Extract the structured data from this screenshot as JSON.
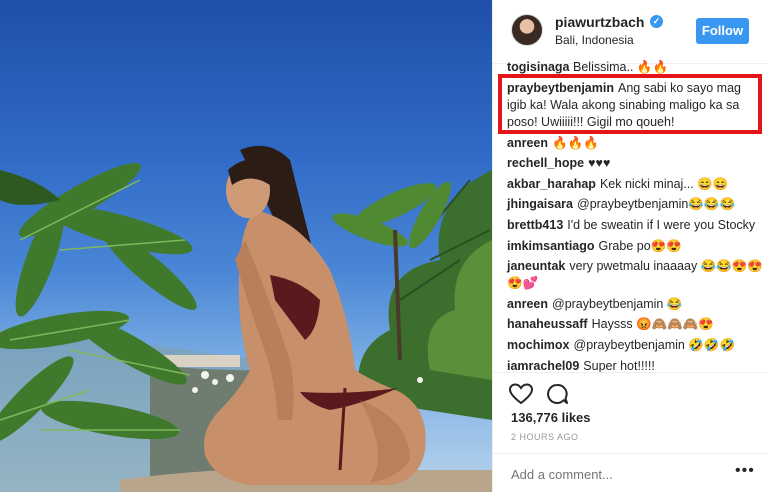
{
  "post": {
    "username": "piawurtzbach",
    "verified_mark": "✓",
    "location": "Bali, Indonesia",
    "follow_label": "Follow"
  },
  "comments": [
    {
      "user": "togisinaga",
      "text": "Belissima.. 🔥🔥"
    },
    {
      "user": "praybeytbenjamin",
      "text": "Ang sabi ko sayo mag igib ka! Wala akong sinabing maligo ka sa poso! Uwiiiii!!! Gigil mo qoueh!"
    },
    {
      "user": "anreen",
      "text": "🔥🔥🔥"
    },
    {
      "user": "rechell_hope",
      "text": "♥♥♥"
    },
    {
      "user": "akbar_harahap",
      "text": "Kek nicki minaj... 😄😄"
    },
    {
      "user": "jhingaisara",
      "text": "@praybeytbenjamin😂😂😂"
    },
    {
      "user": "brettb413",
      "text": "I'd be sweatin if I were you Stocky"
    },
    {
      "user": "imkimsantiago",
      "text": "Grabe po😍😍"
    },
    {
      "user": "janeuntak",
      "text": "very pwetmalu inaaaay 😂😂😍😍😍💕"
    },
    {
      "user": "anreen",
      "text": "@praybeytbenjamin 😂"
    },
    {
      "user": "hanaheussaff",
      "text": "Haysss 😡🙈🙈🙈😍"
    },
    {
      "user": "mochimox",
      "text": "@praybeytbenjamin 🤣🤣🤣"
    },
    {
      "user": "iamrachel09",
      "text": "Super hot!!!!!"
    }
  ],
  "actions": {
    "heart_icon": "heart-icon",
    "comment_icon": "comment-icon",
    "likes": "136,776 likes",
    "time": "2 HOURS AGO",
    "add_comment_placeholder": "Add a comment...",
    "more_label": "•••"
  },
  "colors": {
    "accent": "#3897f0",
    "highlight_box": "#e4141b",
    "text": "#262626",
    "muted": "#999999"
  }
}
